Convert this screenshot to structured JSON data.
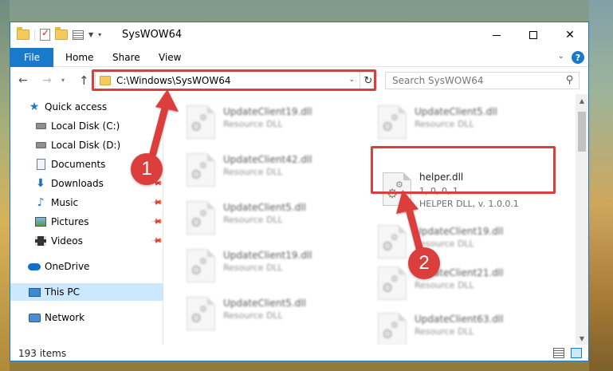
{
  "window": {
    "title": "SysWOW64"
  },
  "ribbon": {
    "tabs": [
      "File",
      "Home",
      "Share",
      "View"
    ],
    "help_label": "?"
  },
  "address": {
    "path": "C:\\Windows\\SysWOW64"
  },
  "search": {
    "placeholder": "Search SysWOW64"
  },
  "sidebar": {
    "items": [
      {
        "label": "Quick access",
        "icon": "star-icon",
        "pinned": false
      },
      {
        "label": "Local Disk (C:)",
        "icon": "drive-icon",
        "pinned": false
      },
      {
        "label": "Local Disk (D:)",
        "icon": "drive-icon",
        "pinned": false
      },
      {
        "label": "Documents",
        "icon": "documents-icon",
        "pinned": true
      },
      {
        "label": "Downloads",
        "icon": "downloads-icon",
        "pinned": true
      },
      {
        "label": "Music",
        "icon": "music-icon",
        "pinned": true
      },
      {
        "label": "Pictures",
        "icon": "pictures-icon",
        "pinned": true
      },
      {
        "label": "Videos",
        "icon": "videos-icon",
        "pinned": true
      },
      {
        "label": "OneDrive",
        "icon": "onedrive-icon",
        "pinned": false
      },
      {
        "label": "This PC",
        "icon": "this-pc-icon",
        "pinned": false,
        "selected": true
      },
      {
        "label": "Network",
        "icon": "network-icon",
        "pinned": false
      }
    ]
  },
  "files": {
    "left_column": [
      {
        "name": "UpdateClient19.dll",
        "desc": "Resource DLL"
      },
      {
        "name": "UpdateClient42.dll",
        "desc": "Resource DLL"
      },
      {
        "name": "UpdateClient5.dll",
        "desc": "Resource DLL"
      },
      {
        "name": "UpdateClient19.dll",
        "desc": "Resource DLL"
      },
      {
        "name": "UpdateClient5.dll",
        "desc": "Resource DLL"
      }
    ],
    "right_column": [
      {
        "name": "UpdateClient5.dll",
        "desc": "Resource DLL"
      },
      {
        "name": "UpdateClient19.dll",
        "desc": "Resource DLL"
      },
      {
        "name": "UpdateClient21.dll",
        "desc": "Resource DLL"
      },
      {
        "name": "UpdateClient63.dll",
        "desc": "Resource DLL"
      }
    ],
    "highlighted": {
      "name": "helper.dll",
      "version": "1, 0, 0, 1",
      "desc": "HELPER DLL, v. 1.0.0.1"
    }
  },
  "status": {
    "item_count": "193 items"
  },
  "callouts": {
    "step1": "1",
    "step2": "2"
  },
  "colors": {
    "accent": "#1979ca",
    "highlight_red": "#dc3d3d",
    "selection": "#cce8ff"
  }
}
